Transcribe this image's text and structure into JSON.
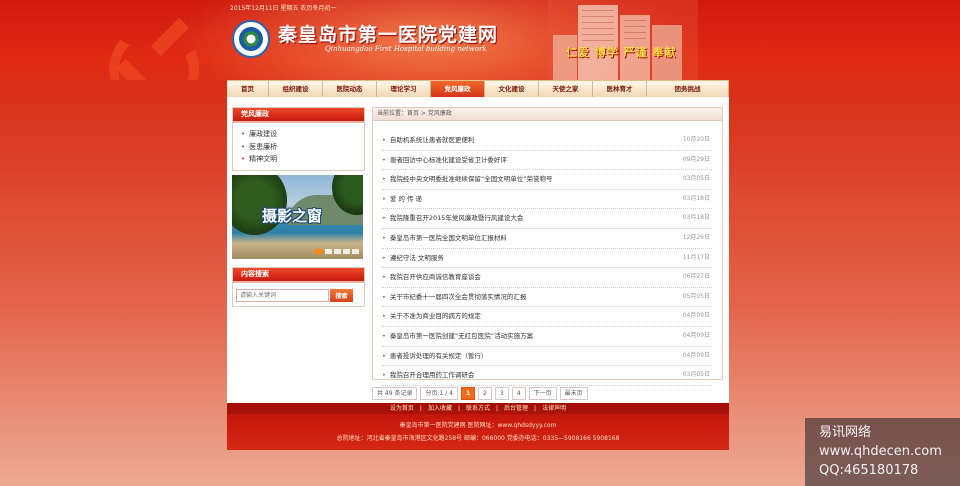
{
  "header": {
    "date": "2015年12月11日 星期五 农历冬月初一",
    "title": "秦皇岛市第一医院党建网",
    "subtitle": "Qinhuangdao First Hospital building network",
    "slogan": "仁爱 博学 严谨 奉献"
  },
  "nav": {
    "items": [
      {
        "label": "首页",
        "w": 42
      },
      {
        "label": "组织建设",
        "w": 54
      },
      {
        "label": "医院动态",
        "w": 54
      },
      {
        "label": "理论学习",
        "w": 54
      },
      {
        "label": "党风廉政",
        "w": 54,
        "active": true
      },
      {
        "label": "文化建设",
        "w": 54
      },
      {
        "label": "天使之家",
        "w": 54
      },
      {
        "label": "医林育才",
        "w": 54
      },
      {
        "label": "团务挑战",
        "w": 82
      }
    ]
  },
  "sidebar": {
    "category_title": "党风廉政",
    "items": [
      "廉政建设",
      "医患廉桥",
      "精神文明"
    ],
    "photo_caption": "摄影之窗",
    "search_title": "内容搜索",
    "search_placeholder": "请输入关键词",
    "search_button": "搜索"
  },
  "main": {
    "breadcrumb": "当前位置：首页 > 党风廉政",
    "articles": [
      {
        "title": "自助机系统让患者就医更便利",
        "date": "10月20日"
      },
      {
        "title": "患者回访中心标准化建设受省卫计委好评",
        "date": "09月29日"
      },
      {
        "title": "我院经中央文明委批准继续保留“全国文明单位”荣誉称号",
        "date": "03月05日"
      },
      {
        "title": "爱 的 传 递",
        "date": "03月18日"
      },
      {
        "title": "我院隆重召开2015年党风廉政暨行风建设大会",
        "date": "03月18日"
      },
      {
        "title": "秦皇岛市第一医院全国文明单位汇报材料",
        "date": "12月26日"
      },
      {
        "title": "遵纪守法 文明服务",
        "date": "11月17日"
      },
      {
        "title": "我院召开供应商诚信教育座谈会",
        "date": "06月27日"
      },
      {
        "title": "关于市纪委十一届四次全会贯彻落实情况的汇报",
        "date": "05月05日"
      },
      {
        "title": "关于不准为商业目的病方的规定",
        "date": "04月09日"
      },
      {
        "title": "秦皇岛市第一医院创建“无红包医院”活动实施方案",
        "date": "04月09日"
      },
      {
        "title": "患者投诉处理的有关规定（暂行）",
        "date": "04月09日"
      },
      {
        "title": "我院召开合理用药工作调研会",
        "date": "03月05日"
      }
    ]
  },
  "pager": {
    "total": "共 49 条记录",
    "page_info": "分页:1 / 4",
    "pages": [
      "1",
      "2",
      "3",
      "4"
    ],
    "current": "1",
    "next": "下一页",
    "last": "最末页"
  },
  "footer": {
    "links": [
      "设为首页",
      "加入收藏",
      "联系方式",
      "后台管理",
      "法律声明"
    ],
    "line1": "秦皇岛市第一医院党建网    医院网址：www.qhdsdyyy.com",
    "line2": "总院地址：河北省秦皇岛市海港区文化路258号   邮编：066000    党委办电话：0335—5908166 5908168"
  },
  "watermark": {
    "line1": "易讯网络",
    "line2": "www.qhdecen.com",
    "line3": "QQ:465180178"
  },
  "colors": {
    "primary_red": "#d01a10",
    "accent_orange": "#f26a1a",
    "nav_bg": "#f0d9b4"
  }
}
